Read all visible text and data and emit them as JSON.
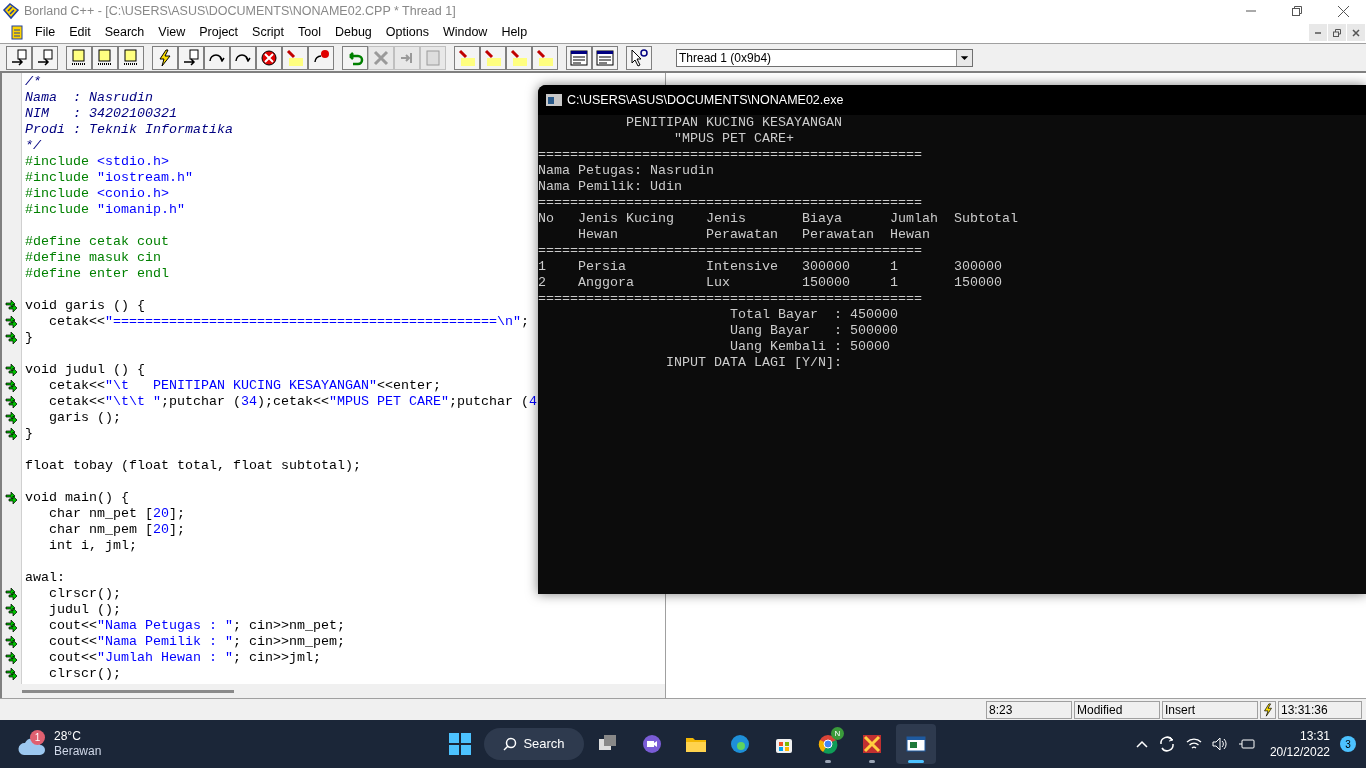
{
  "window": {
    "title": "Borland C++ - [C:\\USERS\\ASUS\\DOCUMENTS\\NONAME02.CPP * Thread 1]"
  },
  "menu": [
    "File",
    "Edit",
    "Search",
    "View",
    "Project",
    "Script",
    "Tool",
    "Debug",
    "Options",
    "Window",
    "Help"
  ],
  "toolbar": [
    {
      "disabled": false
    },
    {
      "disabled": false
    },
    {
      "disabled": false
    },
    {
      "disabled": false
    },
    {
      "disabled": false
    },
    {
      "disabled": false
    },
    {
      "disabled": false
    },
    {
      "disabled": false
    },
    {
      "disabled": false
    },
    {
      "disabled": false
    },
    {
      "disabled": false
    },
    {
      "disabled": false
    },
    {
      "disabled": false
    },
    {
      "disabled": true
    },
    {
      "disabled": true
    },
    {
      "disabled": true
    },
    {
      "disabled": false
    },
    {
      "disabled": false
    },
    {
      "disabled": false
    },
    {
      "disabled": false
    },
    {
      "disabled": false
    },
    {
      "disabled": false
    },
    {
      "disabled": false
    }
  ],
  "thread_select": {
    "value": "Thread 1 (0x9b4)"
  },
  "editor": {
    "lines": [
      {
        "marker": false,
        "segments": [
          {
            "kind": "comment",
            "text": "/*"
          }
        ]
      },
      {
        "marker": false,
        "segments": [
          {
            "kind": "comment",
            "text": "Nama  : Nasrudin"
          }
        ]
      },
      {
        "marker": false,
        "segments": [
          {
            "kind": "comment",
            "text": "NIM   : 34202100321"
          }
        ]
      },
      {
        "marker": false,
        "segments": [
          {
            "kind": "comment",
            "text": "Prodi : Teknik Informatika"
          }
        ]
      },
      {
        "marker": false,
        "segments": [
          {
            "kind": "comment",
            "text": "*/"
          }
        ]
      },
      {
        "marker": false,
        "segments": [
          {
            "kind": "directive",
            "text": "#include "
          },
          {
            "kind": "string",
            "text": "<stdio.h>"
          }
        ]
      },
      {
        "marker": false,
        "segments": [
          {
            "kind": "directive",
            "text": "#include "
          },
          {
            "kind": "string",
            "text": "\"iostream.h\""
          }
        ]
      },
      {
        "marker": false,
        "segments": [
          {
            "kind": "directive",
            "text": "#include "
          },
          {
            "kind": "string",
            "text": "<conio.h>"
          }
        ]
      },
      {
        "marker": false,
        "segments": [
          {
            "kind": "directive",
            "text": "#include "
          },
          {
            "kind": "string",
            "text": "\"iomanip.h\""
          }
        ]
      },
      {
        "marker": false
      },
      {
        "marker": false,
        "segments": [
          {
            "kind": "directive",
            "text": "#define cetak cout"
          }
        ]
      },
      {
        "marker": false,
        "segments": [
          {
            "kind": "directive",
            "text": "#define masuk cin"
          }
        ]
      },
      {
        "marker": false,
        "segments": [
          {
            "kind": "directive",
            "text": "#define enter endl"
          }
        ]
      },
      {
        "marker": false
      },
      {
        "marker": true,
        "segments": [
          {
            "kind": "plain",
            "text": "void garis () {"
          }
        ]
      },
      {
        "marker": true,
        "segments": [
          {
            "kind": "plain",
            "text": "   cetak<<"
          },
          {
            "kind": "string",
            "text": "\"================================================\\n\""
          },
          {
            "kind": "plain",
            "text": ";"
          }
        ]
      },
      {
        "marker": true,
        "segments": [
          {
            "kind": "plain",
            "text": "}"
          }
        ]
      },
      {
        "marker": false
      },
      {
        "marker": true,
        "segments": [
          {
            "kind": "plain",
            "text": "void judul () {"
          }
        ]
      },
      {
        "marker": true,
        "segments": [
          {
            "kind": "plain",
            "text": "   cetak<<"
          },
          {
            "kind": "string",
            "text": "\"\\t   PENITIPAN KUCING KESAYANGAN\""
          },
          {
            "kind": "plain",
            "text": "<<enter;"
          }
        ]
      },
      {
        "marker": true,
        "segments": [
          {
            "kind": "plain",
            "text": "   cetak<<"
          },
          {
            "kind": "string",
            "text": "\"\\t\\t \""
          },
          {
            "kind": "plain",
            "text": ";putchar ("
          },
          {
            "kind": "string",
            "text": "34"
          },
          {
            "kind": "plain",
            "text": ");cetak<<"
          },
          {
            "kind": "string",
            "text": "\"MPUS PET CARE\""
          },
          {
            "kind": "plain",
            "text": ";putchar ("
          },
          {
            "kind": "string",
            "text": "4"
          }
        ]
      },
      {
        "marker": true,
        "segments": [
          {
            "kind": "plain",
            "text": "   garis ();"
          }
        ]
      },
      {
        "marker": true,
        "segments": [
          {
            "kind": "plain",
            "text": "}"
          }
        ]
      },
      {
        "marker": false
      },
      {
        "marker": false,
        "segments": [
          {
            "kind": "plain",
            "text": "float tobay (float total, float subtotal);"
          }
        ]
      },
      {
        "marker": false
      },
      {
        "marker": true,
        "segments": [
          {
            "kind": "plain",
            "text": "void main() {"
          }
        ]
      },
      {
        "marker": false,
        "segments": [
          {
            "kind": "plain",
            "text": "   char nm_pet ["
          },
          {
            "kind": "string",
            "text": "20"
          },
          {
            "kind": "plain",
            "text": "];"
          }
        ]
      },
      {
        "marker": false,
        "segments": [
          {
            "kind": "plain",
            "text": "   char nm_pem ["
          },
          {
            "kind": "string",
            "text": "20"
          },
          {
            "kind": "plain",
            "text": "];"
          }
        ]
      },
      {
        "marker": false,
        "segments": [
          {
            "kind": "plain",
            "text": "   int i, jml;"
          }
        ]
      },
      {
        "marker": false
      },
      {
        "marker": false,
        "segments": [
          {
            "kind": "plain",
            "text": "awal:"
          }
        ]
      },
      {
        "marker": true,
        "segments": [
          {
            "kind": "plain",
            "text": "   clrscr();"
          }
        ]
      },
      {
        "marker": true,
        "segments": [
          {
            "kind": "plain",
            "text": "   judul ();"
          }
        ]
      },
      {
        "marker": true,
        "segments": [
          {
            "kind": "plain",
            "text": "   cout<<"
          },
          {
            "kind": "string",
            "text": "\"Nama Petugas : \""
          },
          {
            "kind": "plain",
            "text": "; cin>>nm_pet;"
          }
        ]
      },
      {
        "marker": true,
        "segments": [
          {
            "kind": "plain",
            "text": "   cout<<"
          },
          {
            "kind": "string",
            "text": "\"Nama Pemilik : \""
          },
          {
            "kind": "plain",
            "text": "; cin>>nm_pem;"
          }
        ]
      },
      {
        "marker": true,
        "segments": [
          {
            "kind": "plain",
            "text": "   cout<<"
          },
          {
            "kind": "string",
            "text": "\"Jumlah Hewan : \""
          },
          {
            "kind": "plain",
            "text": "; cin>>jml;"
          }
        ]
      },
      {
        "marker": true,
        "segments": [
          {
            "kind": "plain",
            "text": "   clrscr();"
          }
        ]
      }
    ]
  },
  "console": {
    "title": "C:\\USERS\\ASUS\\DOCUMENTS\\NONAME02.exe",
    "lines": [
      "           PENITIPAN KUCING KESAYANGAN",
      "                 \"MPUS PET CARE+",
      "================================================",
      "Nama Petugas: Nasrudin",
      "Nama Pemilik: Udin",
      "================================================",
      "No   Jenis Kucing    Jenis       Biaya      Jumlah  Subtotal",
      "     Hewan           Perawatan   Perawatan  Hewan",
      "================================================",
      "1    Persia          Intensive   300000     1       300000",
      "2    Anggora         Lux         150000     1       150000",
      "================================================",
      "                        Total Bayar  : 450000",
      "                        Uang Bayar   : 500000",
      "                        Uang Kembali : 50000",
      "                INPUT DATA LAGI [Y/N]:"
    ]
  },
  "status_bar": {
    "position": "8:23",
    "state": "Modified",
    "mode": "Insert",
    "time": "13:31:36"
  },
  "taskbar": {
    "weather": {
      "badge": "1",
      "temperature": "28°C",
      "condition": "Berawan"
    },
    "search": "Search",
    "apps": [
      {
        "running": false,
        "active": false
      },
      {
        "running": false,
        "active": false
      },
      {
        "running": false,
        "active": false
      },
      {
        "running": false,
        "active": false
      },
      {
        "running": false,
        "active": false
      },
      {
        "running": true,
        "active": false,
        "badge": "N"
      },
      {
        "running": true,
        "active": false
      },
      {
        "running": true,
        "active": true
      }
    ],
    "clock": {
      "time": "13:31",
      "date": "20/12/2022"
    },
    "notifications": "3"
  }
}
